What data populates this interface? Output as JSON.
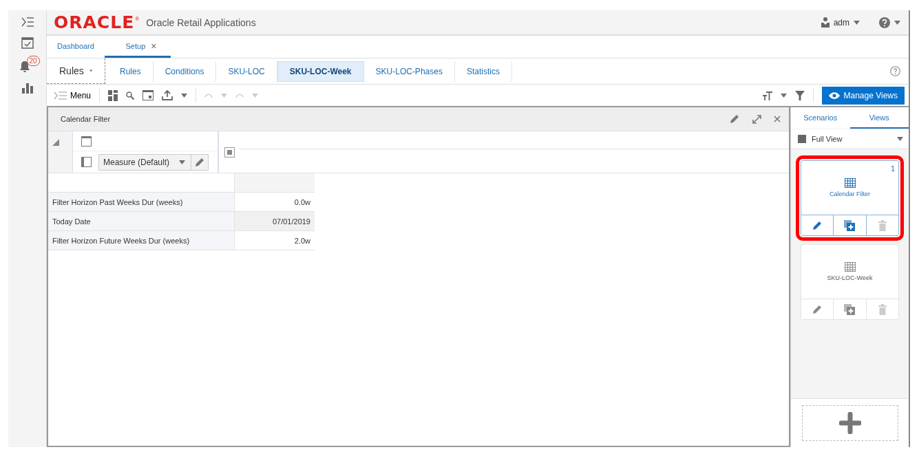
{
  "nav": {
    "badge": "20"
  },
  "header": {
    "logo": "ORACLE",
    "logo_mark": "®",
    "app_title": "Oracle Retail Applications",
    "user": "adm"
  },
  "tabs": [
    {
      "label": "Dashboard",
      "selected": false
    },
    {
      "label": "Setup",
      "selected": true,
      "close": "×"
    }
  ],
  "rules_menu": "Rules",
  "subtabs": [
    {
      "label": "Rules",
      "selected": false
    },
    {
      "label": "Conditions",
      "selected": false
    },
    {
      "label": "SKU-LOC",
      "selected": false
    },
    {
      "label": "SKU-LOC-Week",
      "selected": true
    },
    {
      "label": "SKU-LOC-Phases",
      "selected": false
    },
    {
      "label": "Statistics",
      "selected": false
    }
  ],
  "toolbar": {
    "menu": "Menu",
    "manage_views": "Manage Views"
  },
  "panel": {
    "title": "Calendar Filter",
    "measure": "Measure (Default)",
    "rows": [
      {
        "label": "Filter Horizon Past Weeks Dur (weeks)",
        "value": "0.0w",
        "editable": true
      },
      {
        "label": "Today Date",
        "value": "07/01/2019",
        "editable": false
      },
      {
        "label": "Filter Horizon Future Weeks Dur (weeks)",
        "value": "2.0w",
        "editable": true
      }
    ]
  },
  "views_panel": {
    "tabs": [
      {
        "label": "Scenarios",
        "selected": false
      },
      {
        "label": "Views",
        "selected": true
      }
    ],
    "view_select": "Full View",
    "cards": [
      {
        "title": "Calendar Filter",
        "number": "1",
        "highlighted": true,
        "active": true
      },
      {
        "title": "SKU-LOC-Week",
        "highlighted": false,
        "active": false
      }
    ]
  }
}
